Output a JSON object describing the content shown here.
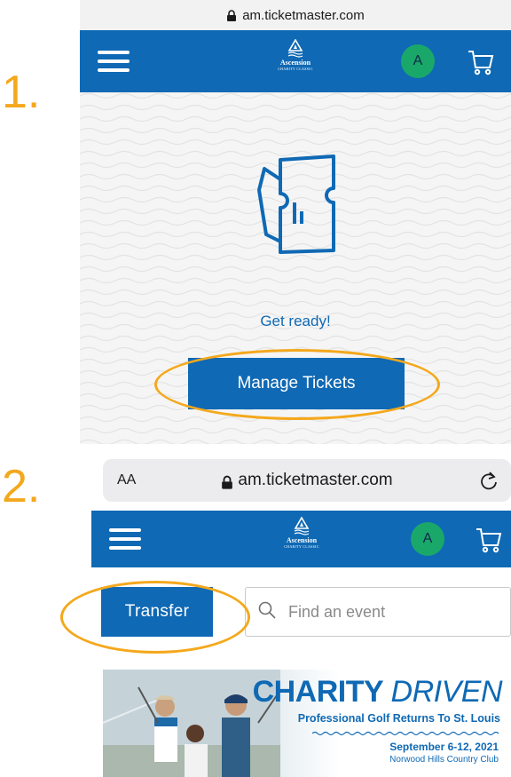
{
  "steps": {
    "first": "1.",
    "second": "2."
  },
  "screen1": {
    "url": "am.ticketmaster.com",
    "logo": {
      "name": "Ascension",
      "sub": "CHARITY CLASSIC"
    },
    "avatar_initial": "A",
    "message": "Get ready!",
    "manage_button": "Manage Tickets"
  },
  "screen2": {
    "text_size_label": "AA",
    "url": "am.ticketmaster.com",
    "logo": {
      "name": "Ascension",
      "sub": "CHARITY CLASSIC"
    },
    "avatar_initial": "A",
    "transfer_button": "Transfer",
    "search_placeholder": "Find an event",
    "banner": {
      "title_bold": "CHARITY",
      "title_italic": "DRIVEN",
      "subtitle": "Professional Golf Returns To St. Louis",
      "date": "September 6-12, 2021",
      "venue": "Norwood Hills Country Club"
    }
  },
  "colors": {
    "brand_blue": "#0f69b4",
    "highlight": "#f4a81c",
    "avatar": "#1aa86a"
  },
  "icons": [
    "lock-icon",
    "hamburger-icon",
    "cart-icon",
    "ticket-icon",
    "reload-icon",
    "search-icon"
  ]
}
